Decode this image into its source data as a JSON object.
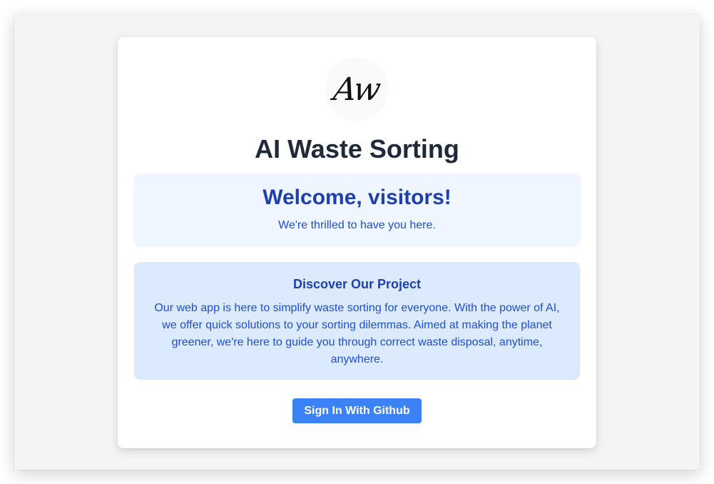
{
  "logo": {
    "text": "Aw"
  },
  "header": {
    "title": "AI Waste Sorting"
  },
  "welcome": {
    "heading": "Welcome, visitors!",
    "subtext": "We're thrilled to have you here."
  },
  "discover": {
    "heading": "Discover Our Project",
    "body": "Our web app is here to simplify waste sorting for everyone. With the power of AI, we offer quick solutions to your sorting dilemmas. Aimed at making the planet greener, we're here to guide you through correct waste disposal, anytime, anywhere."
  },
  "actions": {
    "signin_label": "Sign In With Github"
  },
  "colors": {
    "background": "#f3f4f6",
    "card": "#ffffff",
    "title": "#1f2937",
    "welcome_bg": "#eff6ff",
    "discover_bg": "#dbeafe",
    "accent_text": "#1e40af",
    "button": "#3b82f6"
  }
}
